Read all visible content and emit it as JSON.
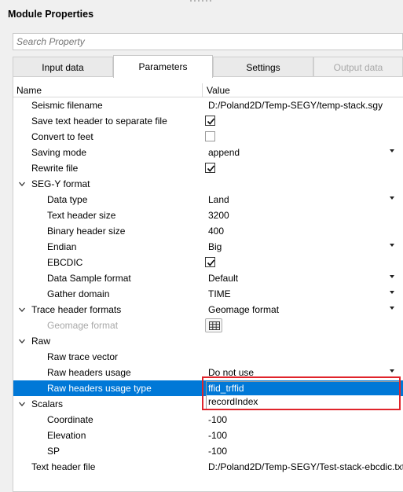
{
  "window": {
    "title": "Module Properties"
  },
  "search": {
    "placeholder": "Search Property"
  },
  "tabs": [
    {
      "label": "Input data"
    },
    {
      "label": "Parameters"
    },
    {
      "label": "Settings"
    },
    {
      "label": "Output data"
    }
  ],
  "columns": {
    "name": "Name",
    "value": "Value"
  },
  "rows": [
    {
      "name": "Seismic filename",
      "value": "D:/Poland2D/Temp-SEGY/temp-stack.sgy"
    },
    {
      "name": "Save text header to separate file",
      "checked": true
    },
    {
      "name": "Convert to feet",
      "checked": false
    },
    {
      "name": "Saving mode",
      "value": "append"
    },
    {
      "name": "Rewrite file",
      "checked": true
    },
    {
      "name": "SEG-Y format"
    },
    {
      "name": "Data type",
      "value": "Land"
    },
    {
      "name": "Text header size",
      "value": "3200"
    },
    {
      "name": "Binary header size",
      "value": "400"
    },
    {
      "name": "Endian",
      "value": "Big"
    },
    {
      "name": "EBCDIC",
      "checked": true
    },
    {
      "name": "Data Sample format",
      "value": "Default"
    },
    {
      "name": "Gather domain",
      "value": "TIME"
    },
    {
      "name": "Trace header formats",
      "value": "Geomage format"
    },
    {
      "name": "Geomage format"
    },
    {
      "name": "Raw"
    },
    {
      "name": "Raw trace vector"
    },
    {
      "name": "Raw headers usage",
      "value": "Do not use"
    },
    {
      "name": "Raw headers usage type"
    },
    {
      "name": "Scalars"
    },
    {
      "name": "Coordinate",
      "value": "-100"
    },
    {
      "name": "Elevation",
      "value": "-100"
    },
    {
      "name": "SP",
      "value": "-100"
    },
    {
      "name": "Text header file",
      "value": "D:/Poland2D/Temp-SEGY/Test-stack-ebcdic.txt"
    }
  ],
  "dropdown": {
    "options": [
      "ffid_trffid",
      "recordIndex"
    ],
    "selected": "ffid_trffid"
  },
  "colors": {
    "selection": "#0078d7",
    "highlight_box": "#e0242b"
  }
}
